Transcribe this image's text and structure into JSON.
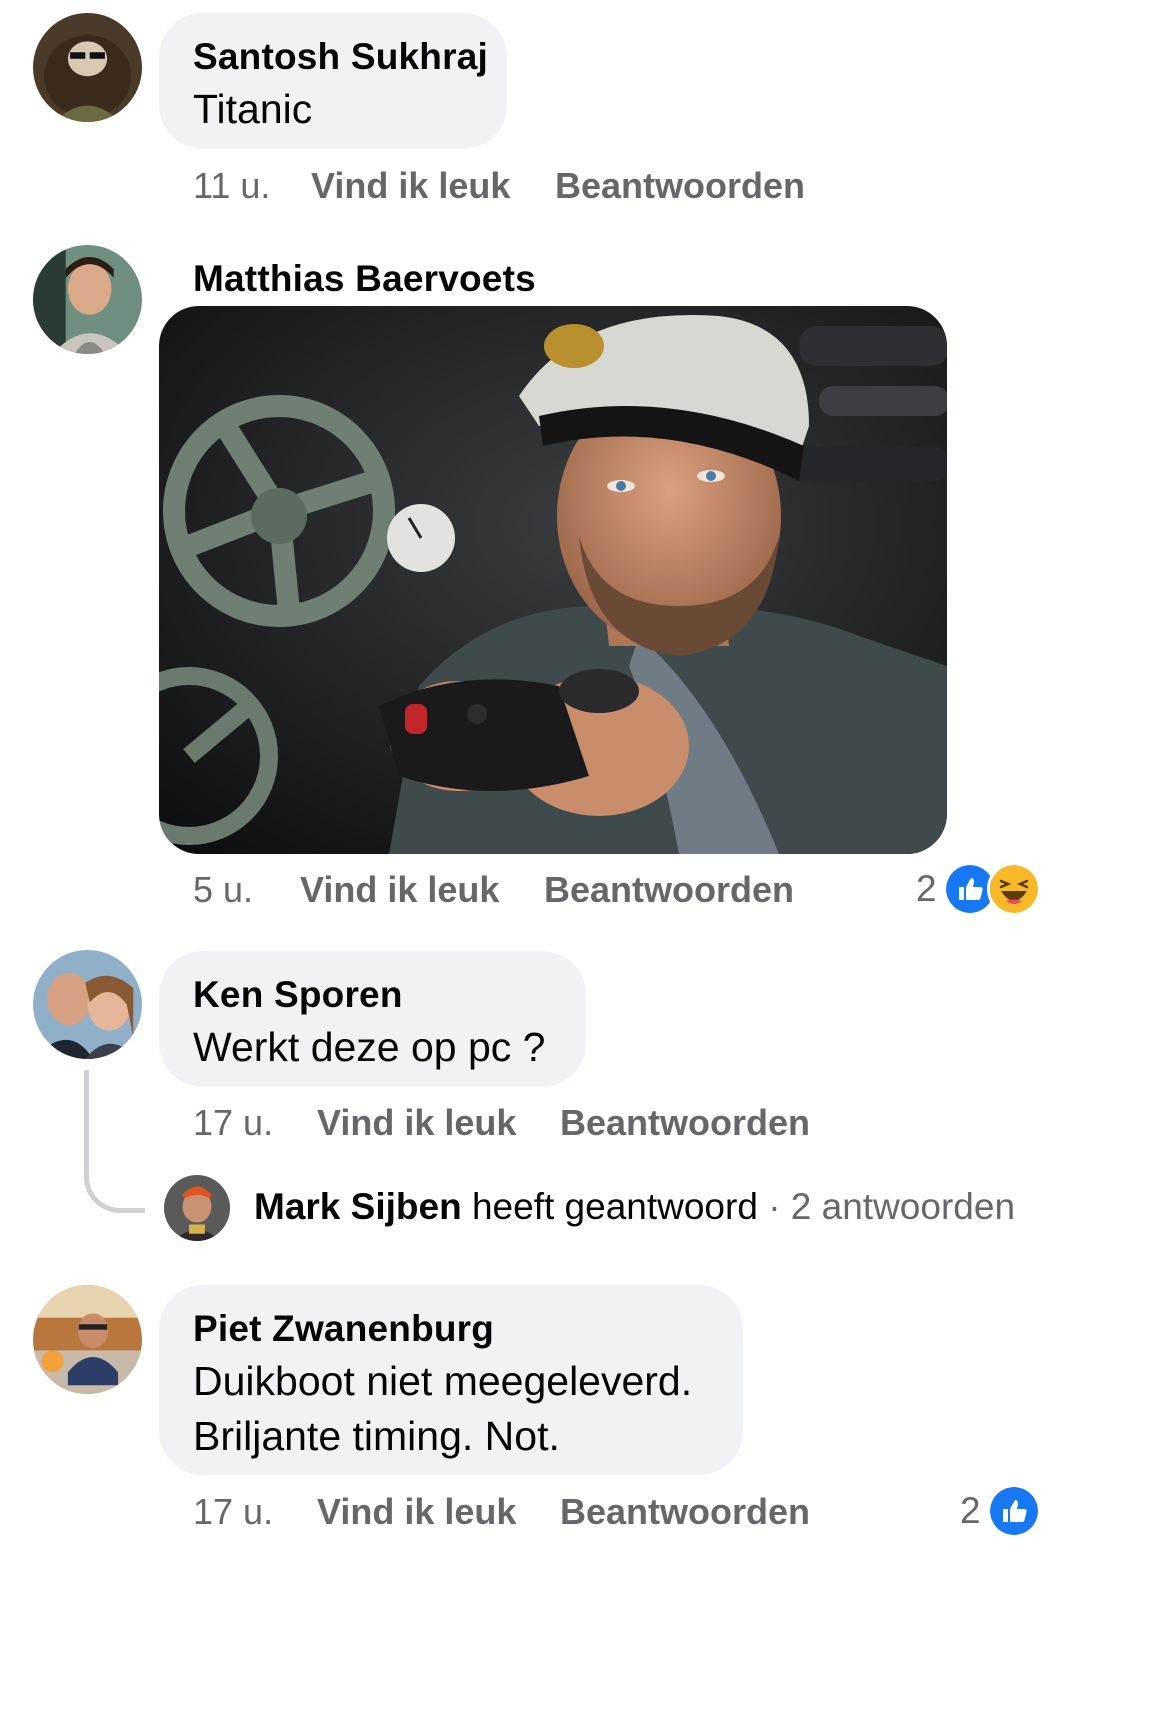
{
  "comments": [
    {
      "author": "Santosh Sukhraj",
      "text": "Titanic",
      "time": "11 u.",
      "like_label": "Vind ik leuk",
      "reply_label": "Beantwoorden"
    },
    {
      "author": "Matthias Baervoets",
      "time": "5 u.",
      "like_label": "Vind ik leuk",
      "reply_label": "Beantwoorden",
      "reaction_count": "2",
      "reactions": [
        "like-icon",
        "haha-icon"
      ],
      "attachment": "submarine-captain-photo"
    },
    {
      "author": "Ken Sporen",
      "text": "Werkt deze op pc ?",
      "time": "17 u.",
      "like_label": "Vind ik leuk",
      "reply_label": "Beantwoorden",
      "reply_summary": {
        "author": "Mark Sijben",
        "action": "heeft geantwoord",
        "separator": "·",
        "count_label": "2 antwoorden"
      }
    },
    {
      "author": "Piet Zwanenburg",
      "text_line1": "Duikboot niet meegeleverd.",
      "text_line2": "Briljante timing. Not.",
      "time": "17 u.",
      "like_label": "Vind ik leuk",
      "reply_label": "Beantwoorden",
      "reaction_count": "2",
      "reactions": [
        "like-icon"
      ]
    }
  ],
  "colors": {
    "bubble": "#f0f2f5",
    "meta_text": "#65676b",
    "like_blue": "#1877f2",
    "haha_yellow": "#f7b928"
  }
}
